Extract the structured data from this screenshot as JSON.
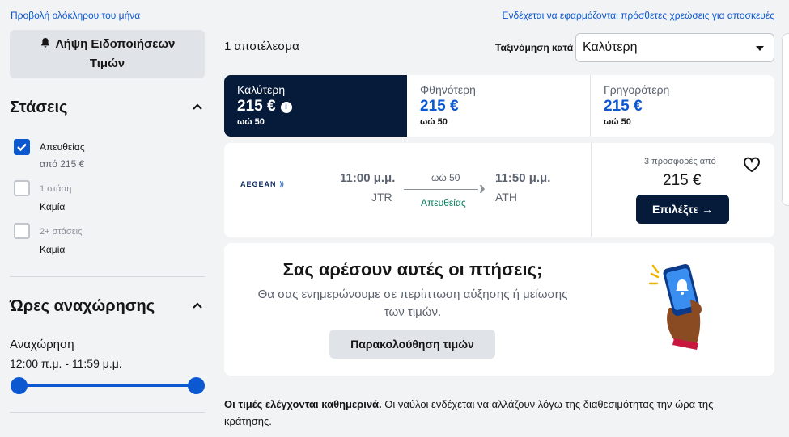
{
  "top": {
    "full_month_link": "Προβολή ολόκληρου του μήνα",
    "fees_link": "Ενδέχεται να εφαρμόζονται πρόσθετες χρεώσεις για αποσκευές"
  },
  "sidebar": {
    "price_alert": {
      "line1": "Λήψη Ειδοποιήσεων",
      "line2": "Τιμών",
      "icon": "bell-icon"
    },
    "stops": {
      "title": "Στάσεις",
      "options": [
        {
          "label": "Απευθείας",
          "sub": "από 215 €",
          "checked": true
        },
        {
          "label": "1 στάση",
          "sub": "Καμία",
          "checked": false
        },
        {
          "label": "2+ στάσεις",
          "sub": "Καμία",
          "checked": false
        }
      ]
    },
    "departure": {
      "title": "Ώρες αναχώρησης",
      "label": "Αναχώρηση",
      "range": "12:00 π.μ. - 11:59 μ.μ.",
      "slider_min": 0,
      "slider_max": 1
    },
    "next_section_partial": "Ώρες αναχώρησης"
  },
  "main": {
    "results_count": "1 αποτέλεσμα",
    "sort_label": "Ταξινόμηση κατά",
    "sort_value": "Καλύτερη",
    "tabs": [
      {
        "name": "Καλύτερη",
        "price": "215 €",
        "duration": "ωώ 50",
        "active": true
      },
      {
        "name": "Φθηνότερη",
        "price": "215 €",
        "duration": "ωώ 50",
        "active": false
      },
      {
        "name": "Γρηγορότερη",
        "price": "215 €",
        "duration": "ωώ 50",
        "active": false
      }
    ],
    "flight": {
      "airline": "AEGEAN",
      "depart_time": "11:00 μ.μ.",
      "depart_code": "JTR",
      "duration": "ωώ 50",
      "stops": "Απευθείας",
      "arrive_time": "11:50 μ.μ.",
      "arrive_code": "ATH",
      "offers": "3 προσφορές από",
      "price": "215 €",
      "select_label": "Επιλέξτε →"
    },
    "promo": {
      "title": "Σας αρέσουν αυτές οι πτήσεις;",
      "text": "Θα σας ενημερώνουμε σε περίπτωση αύξησης ή μείωσης των τιμών.",
      "button": "Παρακολούθηση τιμών"
    },
    "footnote": {
      "bold": "Οι τιμές ελέγχονται καθημερινά.",
      "rest": " Οι ναύλοι ενδέχεται να αλλάζουν λόγω της διαθεσιμότητας την ώρα της κράτησης."
    }
  },
  "colors": {
    "accent": "#0b58d1",
    "dark": "#061a3a",
    "green": "#0a7b5c"
  }
}
